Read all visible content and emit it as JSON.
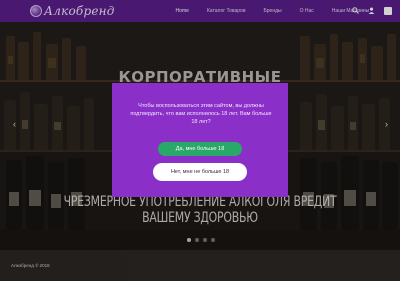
{
  "header": {
    "logo_text": "Алкобренд",
    "nav": [
      {
        "label": "Home",
        "active": true
      },
      {
        "label": "Каталог Товаров"
      },
      {
        "label": "Бренды"
      },
      {
        "label": "О Нас"
      },
      {
        "label": "Наши Магазины"
      }
    ],
    "icons": [
      "search-icon",
      "user-icon",
      "cart-icon"
    ]
  },
  "hero": {
    "title": "КОРПОРАТИВНЫЕ",
    "warning": "ЧРЕЗМЕРНОЕ УПОТРЕБЛЕНИЕ АЛКОГОЛЯ ВРЕДИТ ВАШЕМУ ЗДОРОВЬЮ",
    "arrow_left": "‹",
    "arrow_right": "›",
    "slides_count": 4,
    "active_slide": 1
  },
  "footer": {
    "text": "Алкобренд  © 2018"
  },
  "age_modal": {
    "message": "Чтобы воспользоваться этим сайтом, вы должны подтвердить, что вам исполнилось 18 лет. Вам больше 18 лет?",
    "yes_label": "Да, мне больше 18",
    "no_label": "Нет, мне не больше 18",
    "colors": {
      "background": "#8b2fc9",
      "yes": "#2aa86a",
      "no": "#ffffff"
    }
  }
}
